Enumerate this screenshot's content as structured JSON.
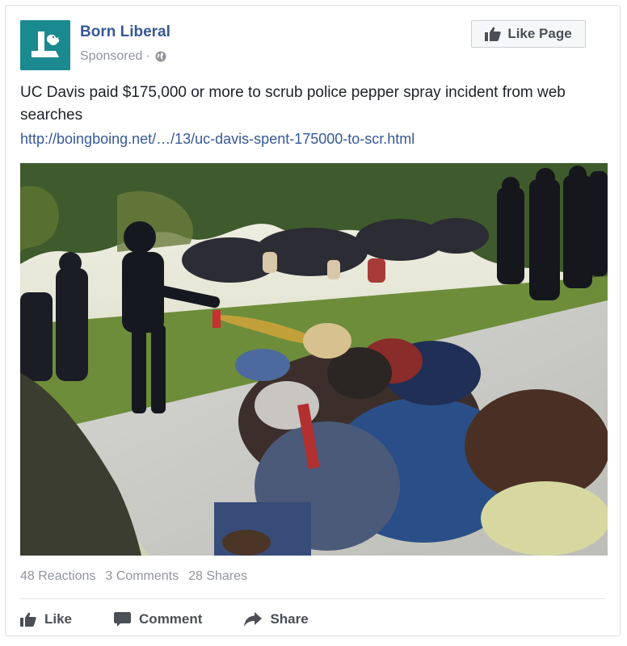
{
  "post": {
    "page_name": "Born Liberal",
    "sponsored_label": "Sponsored",
    "separator": "·",
    "like_page_label": "Like Page",
    "text": "UC Davis paid $175,000 or more to scrub police pepper spray incident from web searches",
    "link": "http://boingboing.net/…/13/uc-davis-spent-175000-to-scr.html",
    "image_icon": "photo-police-pepper-spray-protesters"
  },
  "stats": {
    "reactions": "48 Reactions",
    "comments": "3 Comments",
    "shares": "28 Shares"
  },
  "actions": {
    "like": "Like",
    "comment": "Comment",
    "share": "Share"
  },
  "colors": {
    "link_blue": "#365899",
    "avatar_teal": "#1a8a90",
    "muted_gray": "#90949c",
    "button_text": "#4b4f56"
  }
}
